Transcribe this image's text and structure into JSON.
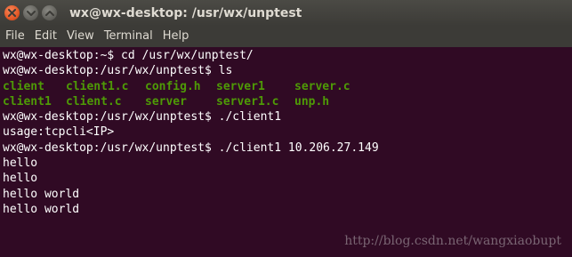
{
  "window": {
    "title": "wx@wx-desktop: /usr/wx/unptest"
  },
  "menu": [
    "File",
    "Edit",
    "View",
    "Terminal",
    "Help"
  ],
  "terminal": {
    "lines_before": [
      "wx@wx-desktop:~$ cd /usr/wx/unptest/",
      "wx@wx-desktop:/usr/wx/unptest$ ls"
    ],
    "ls_rows": [
      [
        "client",
        "client1.c",
        "config.h",
        "server1",
        "server.c"
      ],
      [
        "client1",
        "client.c",
        "server",
        "server1.c",
        "unp.h"
      ]
    ],
    "lines_after": [
      "wx@wx-desktop:/usr/wx/unptest$ ./client1",
      "usage:tcpcli<IP>",
      "wx@wx-desktop:/usr/wx/unptest$ ./client1 10.206.27.149",
      "hello",
      "hello",
      "hello world",
      "hello world"
    ]
  },
  "watermark": "http://blog.csdn.net/wangxiaobupt",
  "colors": {
    "terminal_bg": "#300a24",
    "ls_green": "#4e9a06",
    "close_button": "#e45826"
  }
}
